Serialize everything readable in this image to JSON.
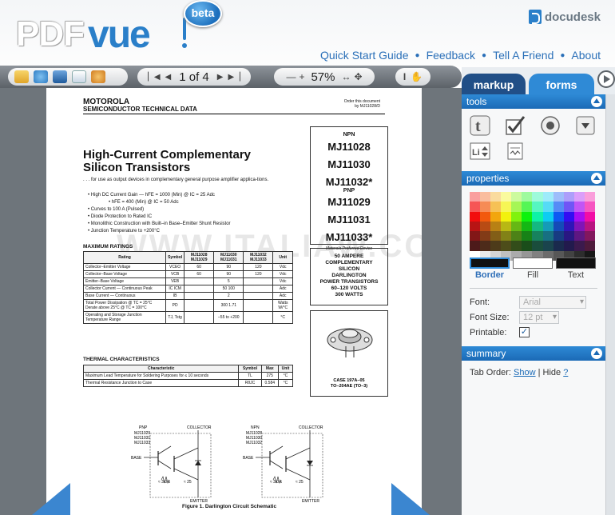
{
  "app": {
    "logo_pdf": "PDF",
    "logo_vue": "vue",
    "beta": "beta",
    "brand": "docudesk"
  },
  "toplinks": [
    "Quick Start Guide",
    "Feedback",
    "Tell A Friend",
    "About"
  ],
  "toolbar": {
    "page_label": "1 of 4",
    "zoom_label": "57%"
  },
  "panel": {
    "tabs": [
      "markup",
      "forms"
    ],
    "active_tab": "forms",
    "tools_header": "tools",
    "properties_header": "properties",
    "swatch_labels": [
      "Border",
      "Fill",
      "Text"
    ],
    "font_label": "Font:",
    "font_value": "Arial",
    "font_size_label": "Font Size:",
    "font_size_value": "12 pt",
    "printable_label": "Printable:",
    "printable_checked": true,
    "summary_header": "summary",
    "tab_order_label": "Tab Order:",
    "tab_order_show": "Show",
    "tab_order_separator": "|",
    "tab_order_hide": "Hide",
    "tab_order_help": "?"
  },
  "document": {
    "manufacturer": "MOTOROLA",
    "subtitle": "SEMICONDUCTOR TECHNICAL DATA",
    "order_line1": "Order this document",
    "order_line2": "by MJ11028/D",
    "title_line1": "High-Current Complementary",
    "title_line2": "Silicon Transistors",
    "description": ". . . for use as output devices in complementary general purpose amplifier applica-tions.",
    "bullets": [
      "High DC Current Gain — hFE = 1000 (Min) @ IC = 25 Adc",
      "hFE = 400 (Min) @ IC = 50 Adc",
      "Curves to 100 A (Pulsed)",
      "Diode Protection to Rated IC",
      "Monolithic Construction with Built–in Base–Emitter Shunt Resistor",
      "Junction Temperature to +200°C"
    ],
    "parts_npn_label": "NPN",
    "parts_pnp_label": "PNP",
    "parts": [
      "MJ11028",
      "MJ11030",
      "MJ11032*",
      "MJ11029",
      "MJ11031",
      "MJ11033*"
    ],
    "preferred": "Motorola Preferred Device",
    "amp_box": [
      "50 AMPERE",
      "COMPLEMENTARY",
      "SILICON",
      "DARLINGTON",
      "POWER TRANSISTORS",
      "60–120 VOLTS",
      "300 WATTS"
    ],
    "case_line1": "CASE 197A–05",
    "case_line2": "TO–204AE (TO–3)",
    "max_ratings_title": "MAXIMUM RATINGS",
    "max_ratings_headers": [
      "Rating",
      "Symbol",
      "MJ11028 MJ11029",
      "MJ11030 MJ11031",
      "MJ11032 MJ11033",
      "Unit"
    ],
    "max_ratings_rows": [
      [
        "Collector–Emitter Voltage",
        "VCEO",
        "60",
        "90",
        "120",
        "Vdc"
      ],
      [
        "Collector–Base Voltage",
        "VCB",
        "60",
        "90",
        "120",
        "Vdc"
      ],
      [
        "Emitter–Base Voltage",
        "VEB",
        "",
        "5",
        "",
        "Vdc"
      ],
      [
        "Collector Current — Continuous Peak",
        "IC ICM",
        "",
        "50 100",
        "",
        "Adc"
      ],
      [
        "Base Current — Continuous",
        "IB",
        "",
        "2",
        "",
        "Adc"
      ],
      [
        "Total Power Dissipation @ TC = 25°C Derate above 25°C @ TC = 100°C",
        "PD",
        "",
        "300 1.71",
        "",
        "Watts W/°C"
      ],
      [
        "Operating and Storage Junction Temperature Range",
        "TJ, Tstg",
        "",
        "–55 to +200",
        "",
        "°C"
      ]
    ],
    "thermal_title": "THERMAL CHARACTERISTICS",
    "thermal_headers": [
      "Characteristic",
      "Symbol",
      "Max",
      "Unit"
    ],
    "thermal_rows": [
      [
        "Maximum Lead Temperature for Soldering Purposes for ≤ 10 seconds",
        "TL",
        "275",
        "°C"
      ],
      [
        "Thermal Resistance Junction to Case",
        "RθJC",
        "0.584",
        "°C"
      ]
    ],
    "circuit_pnp": [
      "PNP",
      "MJ11029",
      "MJ11031",
      "MJ11033"
    ],
    "circuit_npn": [
      "NPN",
      "MJ11028",
      "MJ11030",
      "MJ11032"
    ],
    "circuit_labels": [
      "COLLECTOR",
      "BASE",
      "EMITTER",
      "≈ 3.0 k",
      "≈ 25"
    ],
    "figure_caption": "Figure 1. Darlington Circuit Schematic",
    "watermark": "WWW.ITALIAW.COM"
  },
  "colors": {
    "accent": "#2f8ad6",
    "accent_dark": "#214f87",
    "link": "#2a6fb8"
  }
}
